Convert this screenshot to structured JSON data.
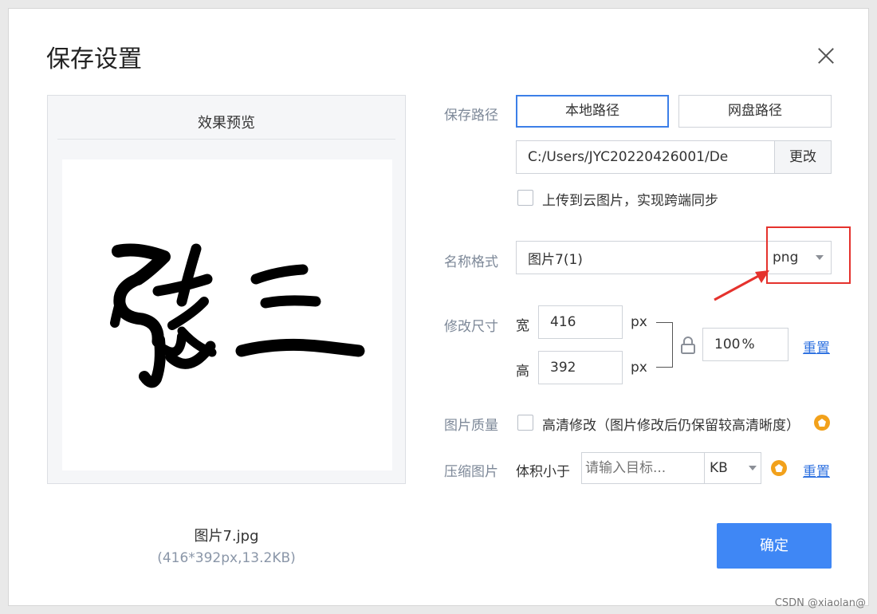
{
  "dialog": {
    "title": "保存设置",
    "close_icon": "close-icon"
  },
  "preview": {
    "title": "效果预览",
    "image_text": "张三",
    "file_name": "图片7.jpg",
    "file_meta": "(416*392px,13.2KB)"
  },
  "save_path": {
    "label": "保存路径",
    "local_button": "本地路径",
    "cloud_button": "网盘路径",
    "path_value": "C:/Users/JYC20220426001/De",
    "change_button": "更改",
    "upload_checkbox_label": "上传到云图片，实现跨端同步"
  },
  "name_format": {
    "label": "名称格式",
    "name_value": "图片7(1)",
    "format_value": "png"
  },
  "resize": {
    "label": "修改尺寸",
    "width_label": "宽",
    "width_value": "416",
    "height_label": "高",
    "height_value": "392",
    "unit": "px",
    "percent_value": "100",
    "percent_sign": "%",
    "reset_link": "重置"
  },
  "quality": {
    "label": "图片质量",
    "hd_checkbox_label": "高清修改（图片修改后仍保留较高清晰度）"
  },
  "compress": {
    "label": "压缩图片",
    "size_prefix": "体积小于",
    "target_placeholder": "请输入目标...",
    "unit_value": "KB",
    "reset_link": "重置"
  },
  "confirm_button": "确定",
  "watermark": "CSDN @xiaolan@",
  "colors": {
    "accent": "#3f87f5",
    "highlight": "#e5322d",
    "vip": "#f2a11b"
  }
}
